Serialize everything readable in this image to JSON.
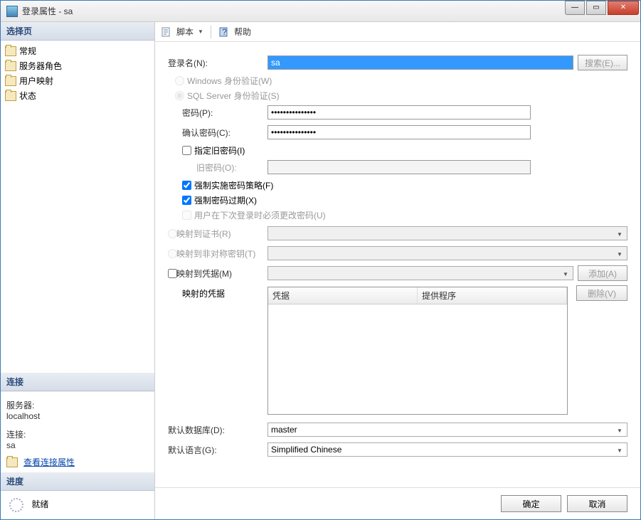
{
  "titlebar": {
    "title": "登录属性 - sa"
  },
  "sidebar": {
    "select_page": "选择页",
    "items": [
      {
        "label": "常规"
      },
      {
        "label": "服务器角色"
      },
      {
        "label": "用户映射"
      },
      {
        "label": "状态"
      }
    ],
    "connection_header": "连接",
    "server_label": "服务器:",
    "server_value": "localhost",
    "conn_label": "连接:",
    "conn_value": "sa",
    "view_props": "查看连接属性",
    "progress_header": "进度",
    "ready": "就绪"
  },
  "toolbar": {
    "script": "脚本",
    "help": "帮助"
  },
  "form": {
    "login_name_label": "登录名(N):",
    "login_name_value": "sa",
    "search_btn": "搜索(E)...",
    "auth_windows": "Windows 身份验证(W)",
    "auth_sql": "SQL Server 身份验证(S)",
    "password_label": "密码(P):",
    "password_value": "●●●●●●●●●●●●●●●",
    "confirm_label": "确认密码(C):",
    "confirm_value": "●●●●●●●●●●●●●●●",
    "specify_old": "指定旧密码(I)",
    "old_pw_label": "旧密码(O):",
    "enforce_policy": "强制实施密码策略(F)",
    "enforce_expire": "强制密码过期(X)",
    "must_change": "用户在下次登录时必须更改密码(U)",
    "map_cert": "映射到证书(R)",
    "map_asym": "映射到非对称密钥(T)",
    "map_cred": "映射到凭据(M)",
    "add_btn": "添加(A)",
    "mapped_cred_label": "映射的凭据",
    "col_cred": "凭据",
    "col_provider": "提供程序",
    "remove_btn": "删除(V)",
    "default_db_label": "默认数据库(D):",
    "default_db_value": "master",
    "default_lang_label": "默认语言(G):",
    "default_lang_value": "Simplified Chinese"
  },
  "buttons": {
    "ok": "确定",
    "cancel": "取消"
  }
}
